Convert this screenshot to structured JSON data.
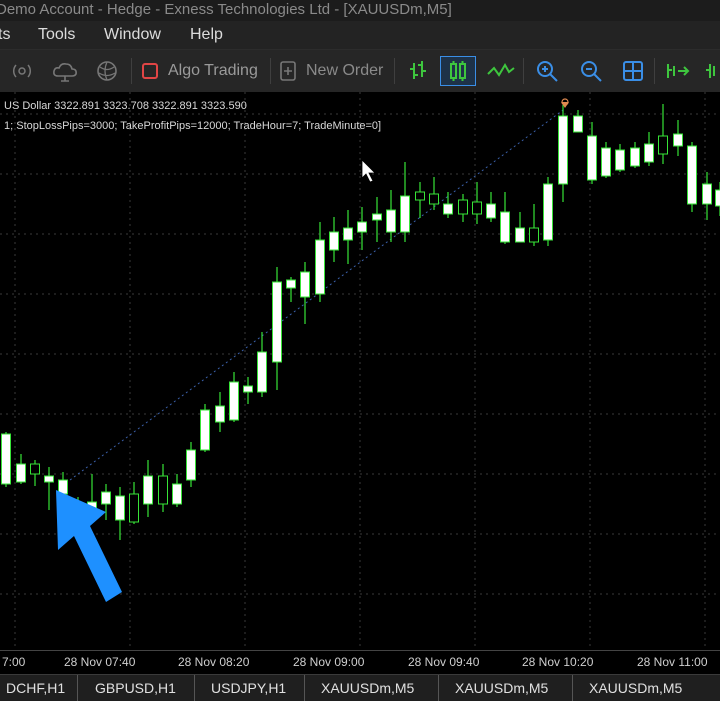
{
  "window": {
    "title": "Demo Account - Hedge - Exness Technologies Ltd - [XAUUSDm,M5]"
  },
  "menu": [
    "ts",
    "Tools",
    "Window",
    "Help"
  ],
  "toolbar": {
    "algo_label": "Algo Trading",
    "new_order_label": "New Order",
    "algo_color": "#e04545",
    "accent": "#3a8ee6"
  },
  "chart": {
    "symbol_line": "US Dollar  3322.891 3323.708 3322.891 3323.590",
    "params_line": "1; StopLossPips=3000; TakeProfitPips=12000; TradeHour=7; TradeMinute=0]",
    "bull_color": "#ffffff",
    "bear_color": "#000000",
    "wick_color": "#37e437",
    "grid_color": "#3a3a3a",
    "arrow_color": "#1e90ff"
  },
  "time_axis": [
    "7:00",
    "28 Nov 07:40",
    "28 Nov 08:20",
    "28 Nov 09:00",
    "28 Nov 09:40",
    "28 Nov 10:20",
    "28 Nov 11:00"
  ],
  "symbol_tabs": [
    "DCHF,H1",
    "GBPUSD,H1",
    "USDJPY,H1",
    "XAUUSDm,M5",
    "XAUUSDm,M5",
    "XAUUSDm,M5"
  ]
}
